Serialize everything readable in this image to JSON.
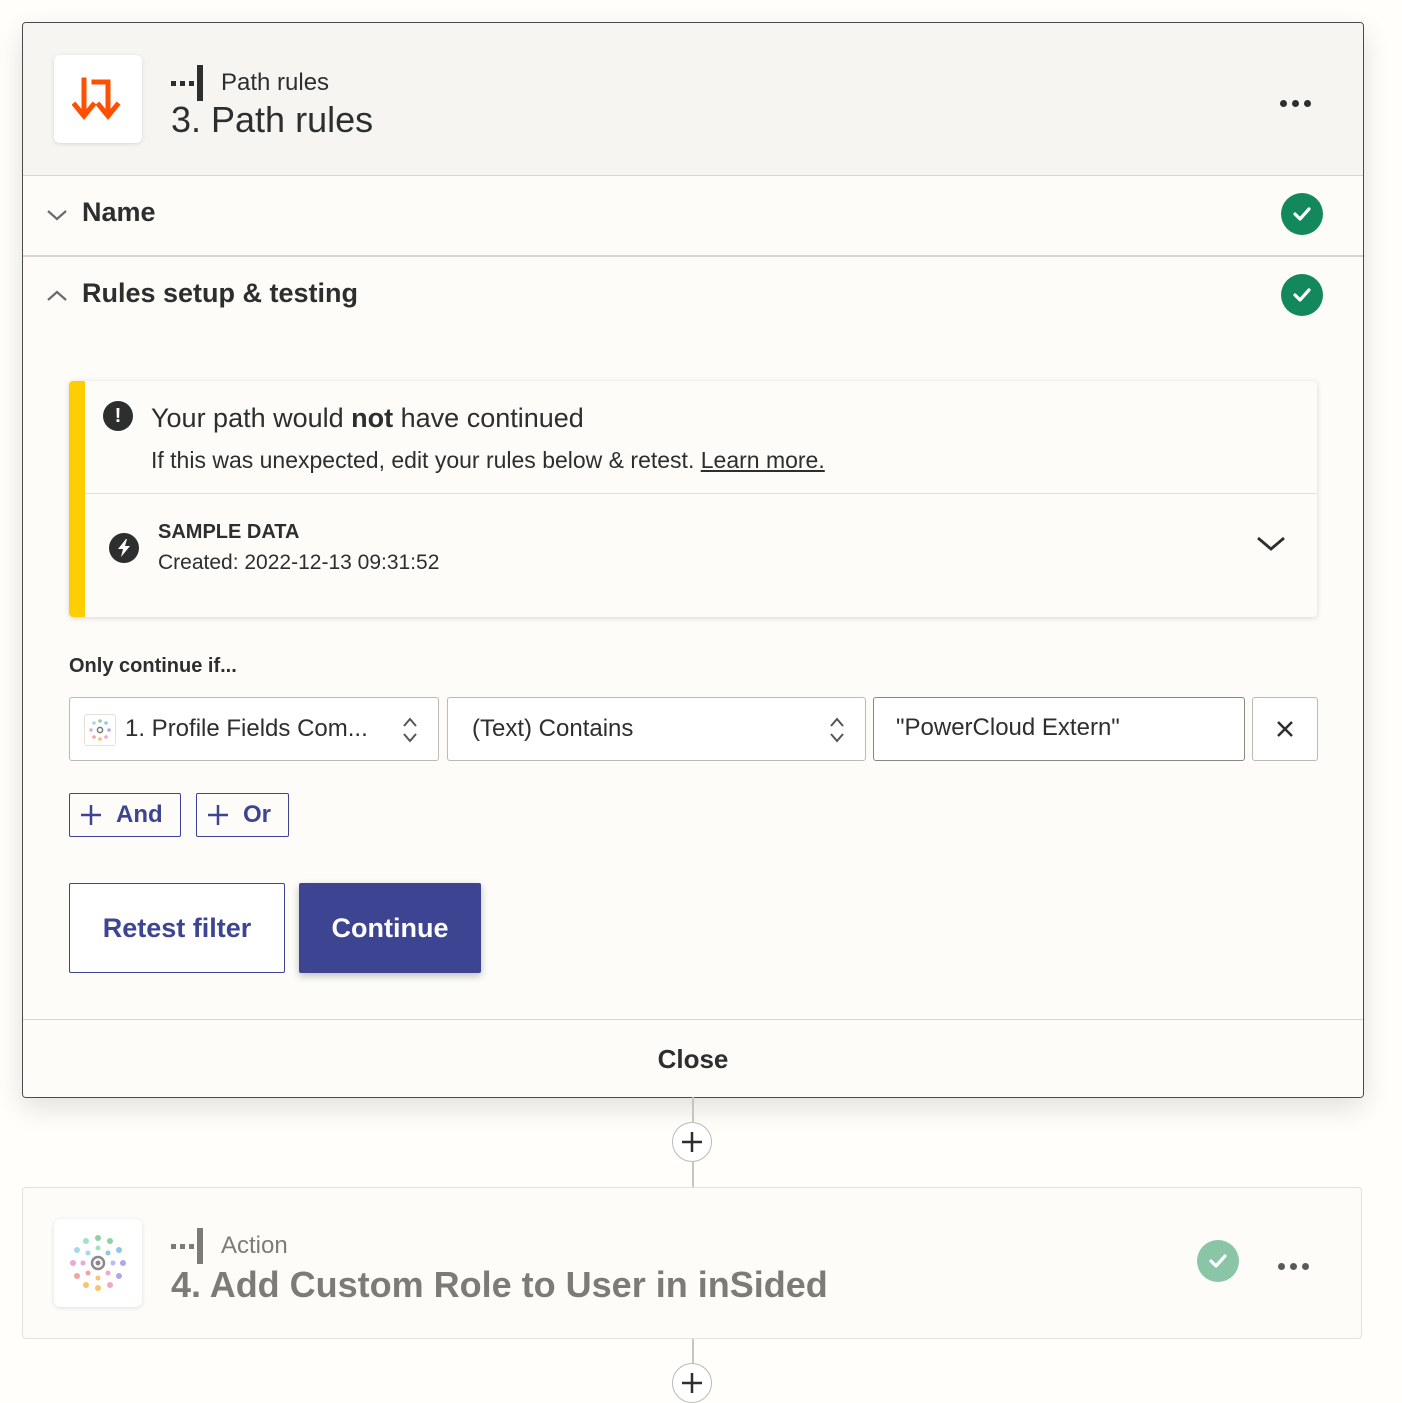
{
  "step3": {
    "type_label": "Path rules",
    "title": "3. Path rules",
    "app_icon": "path-rules-arrows-icon",
    "sections": {
      "name_label": "Name",
      "rules_label": "Rules setup & testing"
    }
  },
  "alert": {
    "headline_pre": "Your path would ",
    "headline_bold": "not",
    "headline_post": " have continued",
    "sub_text": "If this was unexpected, edit your rules below & retest. ",
    "learn_more": "Learn more.",
    "sample_title": "SAMPLE DATA",
    "sample_created": "Created: 2022-12-13 09:31:52"
  },
  "rules": {
    "only_label": "Only continue if...",
    "field_value": "1. Profile Fields Com...",
    "condition_value": "(Text) Contains",
    "match_value": "\"PowerCloud Extern\"",
    "and_label": "And",
    "or_label": "Or"
  },
  "buttons": {
    "retest": "Retest filter",
    "continue": "Continue",
    "close": "Close"
  },
  "step4": {
    "type_label": "Action",
    "title": "4. Add Custom Role to User in inSided"
  },
  "colors": {
    "primary": "#3d4592",
    "success": "#13885c",
    "warning": "#ffce00",
    "brand_orange": "#ff4f00"
  }
}
